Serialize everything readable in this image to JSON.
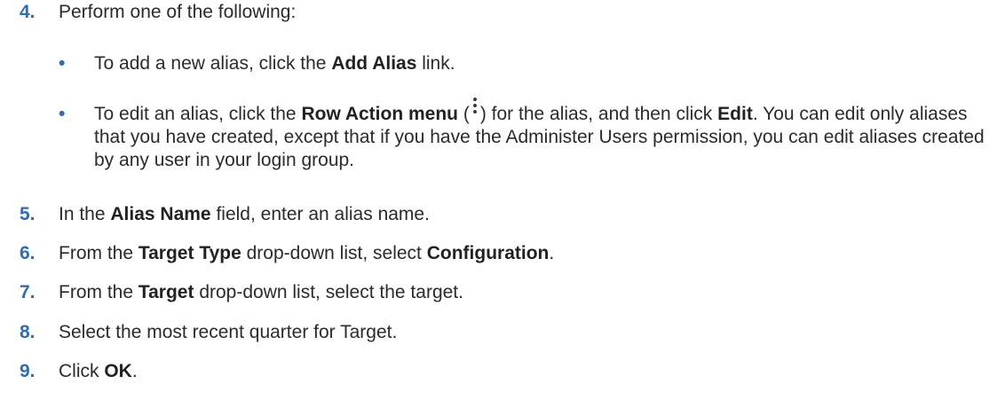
{
  "steps": [
    {
      "num": "4.",
      "text": "Perform one of the following:"
    },
    {
      "num": "5.",
      "a": "In the ",
      "b": "Alias Name",
      "c": " field, enter an alias name."
    },
    {
      "num": "6.",
      "a": "From the ",
      "b": "Target Type",
      "c": " drop-down list, select ",
      "d": "Configuration",
      "e": "."
    },
    {
      "num": "7.",
      "a": "From the ",
      "b": "Target",
      "c": " drop-down list, select the target."
    },
    {
      "num": "8.",
      "text": "Select the most recent quarter for Target."
    },
    {
      "num": "9.",
      "a": "Click ",
      "b": "OK",
      "c": "."
    }
  ],
  "bullets": [
    {
      "dot": "•",
      "a": "To add a new alias, click the ",
      "b": "Add Alias",
      "c": " link."
    },
    {
      "dot": "•",
      "a": "To edit an alias, click the ",
      "b": "Row Action menu",
      "c": " (",
      "d": ") for the alias, and then click ",
      "e": "Edit",
      "f": ". You can edit only aliases that you have created, except that if you have the Administer Users permission, you can edit aliases created by any user in your login group."
    }
  ],
  "icons": {
    "row_action": "more-vertical-icon"
  },
  "colors": {
    "accent": "#2e6db3",
    "text": "#2b2b2b"
  }
}
